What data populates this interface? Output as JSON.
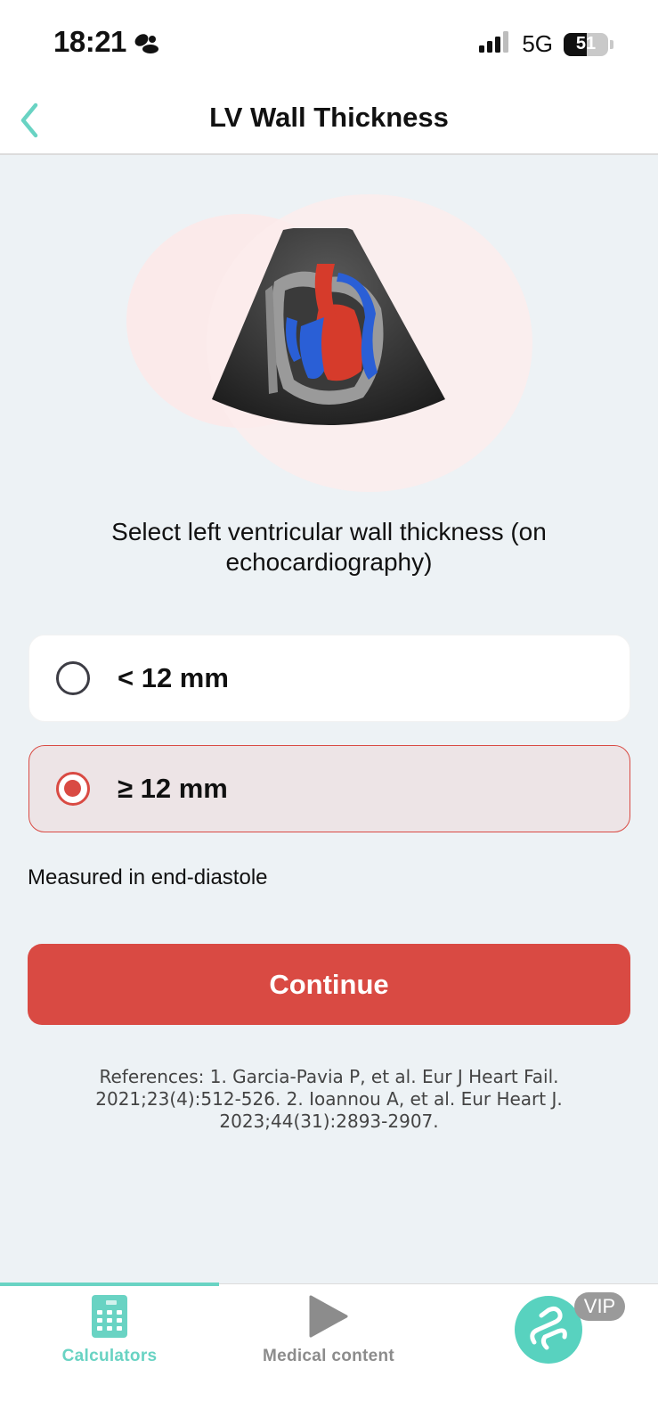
{
  "status_bar": {
    "time": "18:21",
    "network": "5G",
    "battery_level": "51",
    "battery_fraction": 0.51
  },
  "nav": {
    "title": "LV Wall Thickness",
    "back_icon": "chevron-left-icon"
  },
  "hero": {
    "illustration": "heart-echocardiography-illustration"
  },
  "question": "Select left ventricular wall thickness (on echocardiography)",
  "options": [
    {
      "label": "< 12 mm",
      "selected": false
    },
    {
      "label": "≥ 12 mm",
      "selected": true
    }
  ],
  "hint": "Measured in end-diastole",
  "continue_label": "Continue",
  "references": "References: 1. Garcia-Pavia P, et al. Eur J Heart Fail. 2021;23(4):512-526. 2. Ioannou A, et al. Eur Heart J. 2023;44(31):2893-2907.",
  "tabs": [
    {
      "label": "Calculators",
      "icon": "calculator-icon",
      "active": true
    },
    {
      "label": "Medical content",
      "icon": "play-icon",
      "active": false
    }
  ],
  "vip": {
    "badge": "VIP",
    "icon": "app-logo-icon"
  },
  "colors": {
    "accent": "#d94a43",
    "teal": "#69d3c3",
    "background": "#edf2f5"
  }
}
